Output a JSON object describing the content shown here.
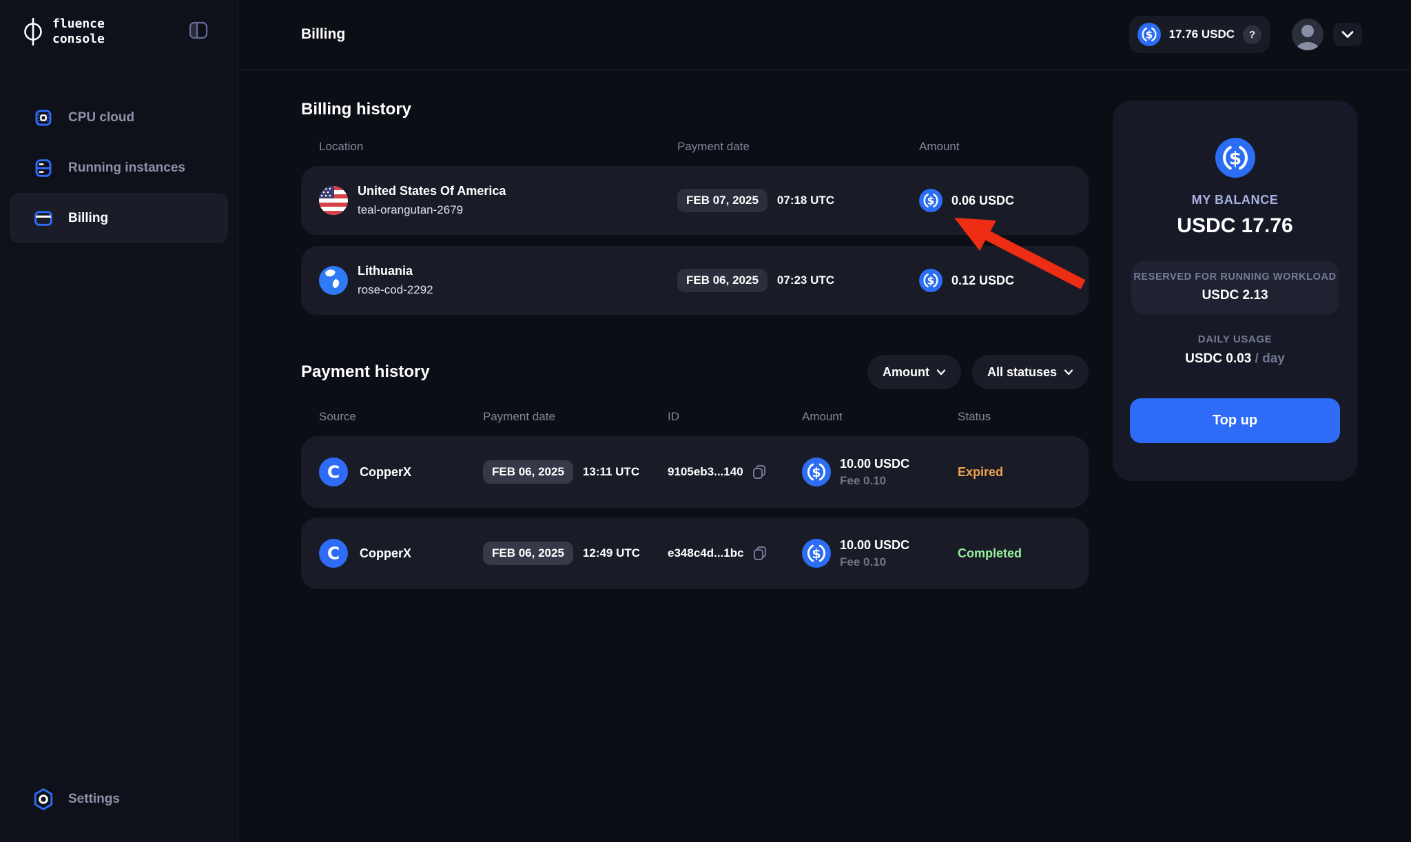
{
  "app": {
    "logo_line1": "fluence",
    "logo_line2": "console"
  },
  "header": {
    "title": "Billing",
    "balance_badge": "17.76 USDC",
    "help_label": "?"
  },
  "sidebar": {
    "items": [
      {
        "label": "CPU cloud"
      },
      {
        "label": "Running instances"
      },
      {
        "label": "Billing"
      }
    ],
    "footer_item": {
      "label": "Settings"
    }
  },
  "billing_history": {
    "title": "Billing history",
    "columns": [
      "Location",
      "Payment date",
      "Amount"
    ],
    "rows": [
      {
        "location": "United States Of America",
        "instance": "teal-orangutan-2679",
        "date": "FEB 07, 2025",
        "time": "07:18 UTC",
        "amount": "0.06 USDC"
      },
      {
        "location": "Lithuania",
        "instance": "rose-cod-2292",
        "date": "FEB 06, 2025",
        "time": "07:23 UTC",
        "amount": "0.12 USDC"
      }
    ]
  },
  "payment_history": {
    "title": "Payment history",
    "filters": {
      "amount": "Amount",
      "status": "All statuses"
    },
    "columns": [
      "Source",
      "Payment date",
      "ID",
      "Amount",
      "Status"
    ],
    "rows": [
      {
        "source": "CopperX",
        "date": "FEB 06, 2025",
        "time": "13:11 UTC",
        "id": "9105eb3...140",
        "amount": "10.00 USDC",
        "fee": "Fee 0.10",
        "status": "Expired",
        "status_color": "#f0a14f"
      },
      {
        "source": "CopperX",
        "date": "FEB 06, 2025",
        "time": "12:49 UTC",
        "id": "e348c4d...1bc",
        "amount": "10.00 USDC",
        "fee": "Fee 0.10",
        "status": "Completed",
        "status_color": "#97ef9c"
      }
    ]
  },
  "balance_panel": {
    "label": "MY BALANCE",
    "balance": "USDC 17.76",
    "reserved_label": "RESERVED FOR RUNNING WORKLOAD",
    "reserved_value": "USDC 2.13",
    "daily_label": "DAILY USAGE",
    "daily_value": "USDC 0.03",
    "daily_suffix": "/ day",
    "topup_label": "Top up"
  },
  "icons": {
    "usdc_symbol": "$",
    "copperx_symbol": "C"
  },
  "colors": {
    "accent_blue": "#2e6bf6",
    "usdc_blue": "#2b6df3",
    "status_expired": "#f0a14f",
    "status_completed": "#97ef9c",
    "arrow_red": "#ee2d15"
  }
}
